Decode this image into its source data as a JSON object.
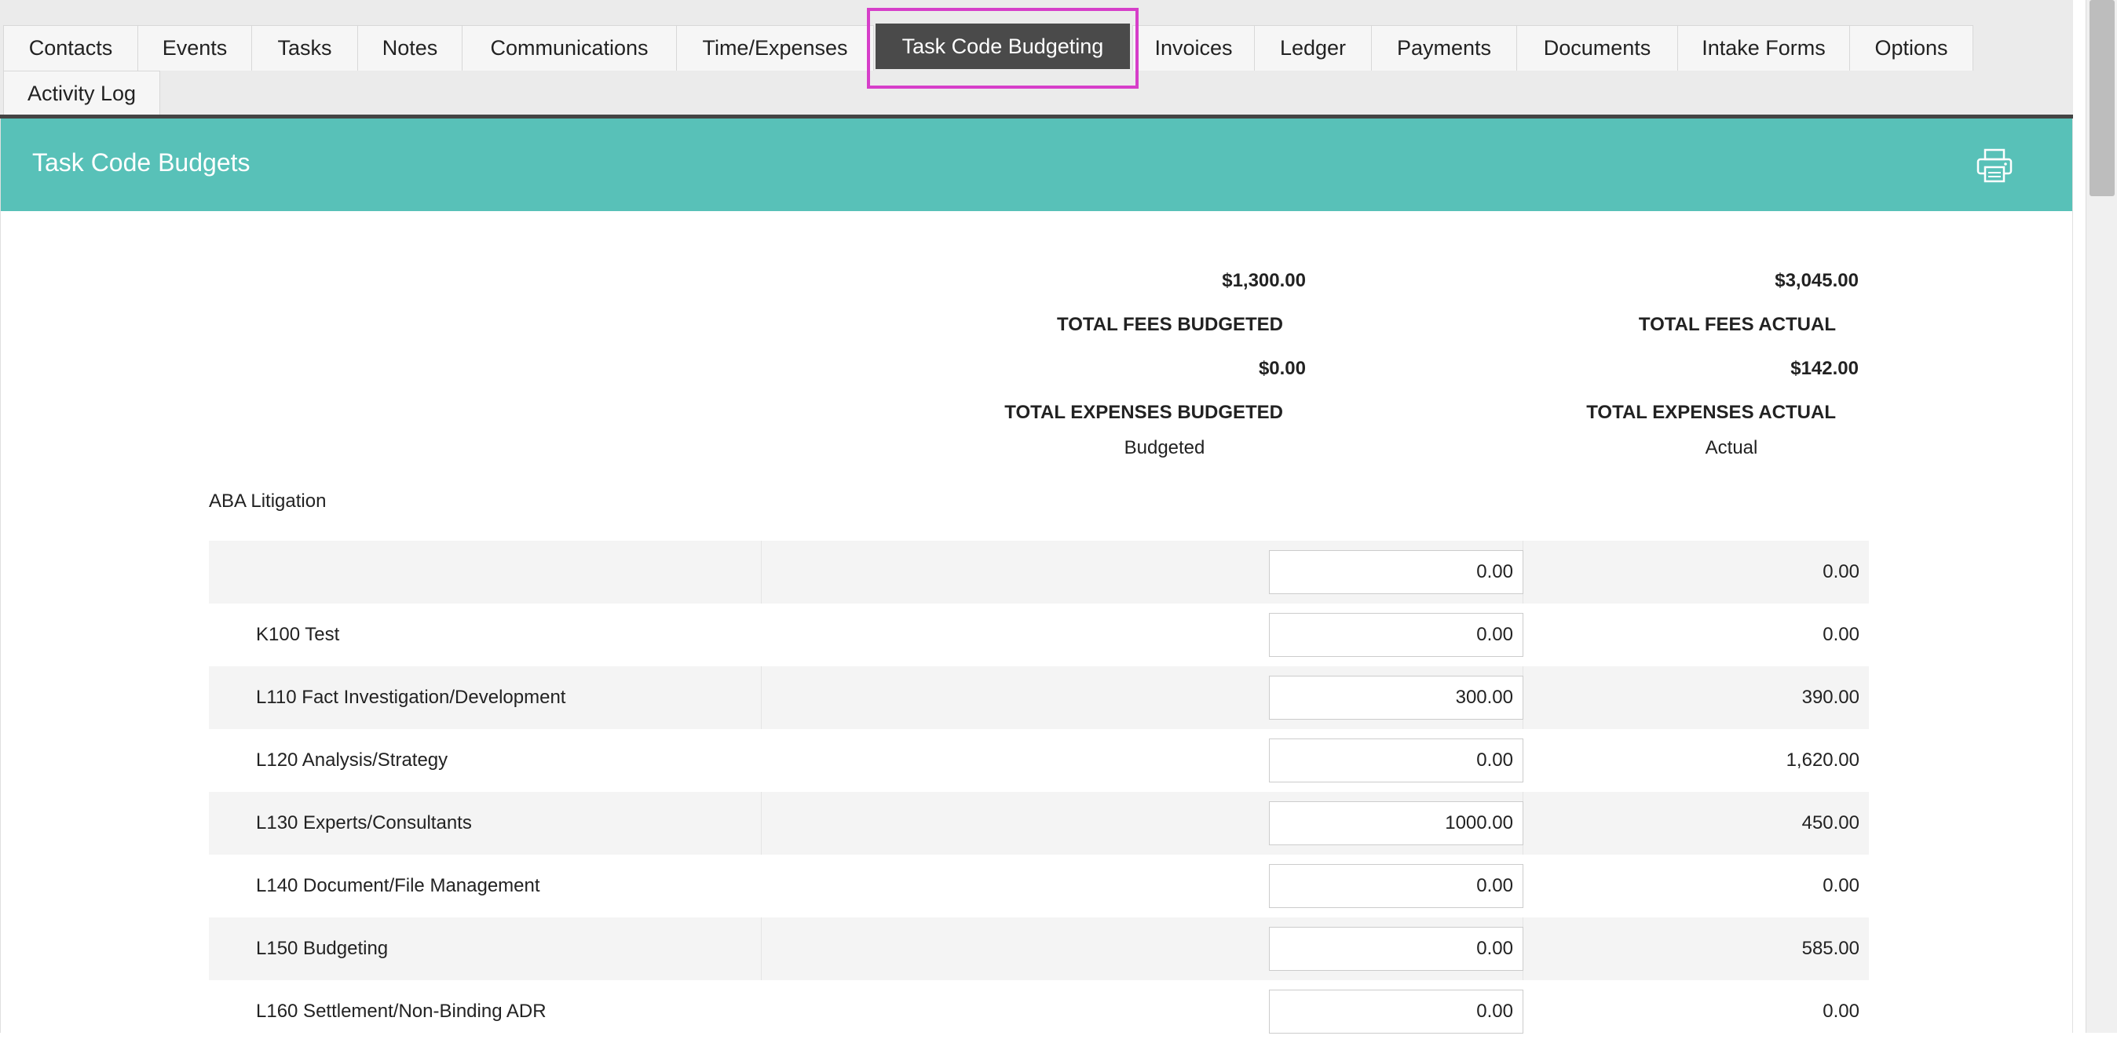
{
  "tabs": [
    {
      "label": "Contacts",
      "active": false
    },
    {
      "label": "Events",
      "active": false
    },
    {
      "label": "Tasks",
      "active": false
    },
    {
      "label": "Notes",
      "active": false
    },
    {
      "label": "Communications",
      "active": false
    },
    {
      "label": "Time/Expenses",
      "active": false
    },
    {
      "label": "Task Code Budgeting",
      "active": true
    },
    {
      "label": "Invoices",
      "active": false
    },
    {
      "label": "Ledger",
      "active": false
    },
    {
      "label": "Payments",
      "active": false
    },
    {
      "label": "Documents",
      "active": false
    },
    {
      "label": "Intake Forms",
      "active": false
    },
    {
      "label": "Options",
      "active": false
    },
    {
      "label": "Activity Log",
      "active": false
    }
  ],
  "panel": {
    "title": "Task Code Budgets",
    "print_icon": "printer-icon"
  },
  "totals": {
    "fees_budgeted_value": "$1,300.00",
    "fees_budgeted_label": "TOTAL FEES BUDGETED",
    "fees_actual_value": "$3,045.00",
    "fees_actual_label": "TOTAL FEES ACTUAL",
    "expenses_budgeted_value": "$0.00",
    "expenses_budgeted_label": "TOTAL EXPENSES BUDGETED",
    "expenses_actual_value": "$142.00",
    "expenses_actual_label": "TOTAL EXPENSES ACTUAL"
  },
  "columns": {
    "budgeted": "Budgeted",
    "actual": "Actual"
  },
  "group": {
    "title": "ABA Litigation",
    "rows": [
      {
        "name": "",
        "budgeted": "0.00",
        "actual": "0.00"
      },
      {
        "name": "K100 Test",
        "budgeted": "0.00",
        "actual": "0.00"
      },
      {
        "name": "L110 Fact Investigation/Development",
        "budgeted": "300.00",
        "actual": "390.00"
      },
      {
        "name": "L120 Analysis/Strategy",
        "budgeted": "0.00",
        "actual": "1,620.00"
      },
      {
        "name": "L130 Experts/Consultants",
        "budgeted": "1000.00",
        "actual": "450.00"
      },
      {
        "name": "L140 Document/File Management",
        "budgeted": "0.00",
        "actual": "0.00"
      },
      {
        "name": "L150 Budgeting",
        "budgeted": "0.00",
        "actual": "585.00"
      },
      {
        "name": "L160 Settlement/Non-Binding ADR",
        "budgeted": "0.00",
        "actual": "0.00"
      }
    ]
  },
  "colors": {
    "header_teal": "#58c1b8",
    "active_tab": "#4a4a4a",
    "highlight": "#d63ec9"
  }
}
